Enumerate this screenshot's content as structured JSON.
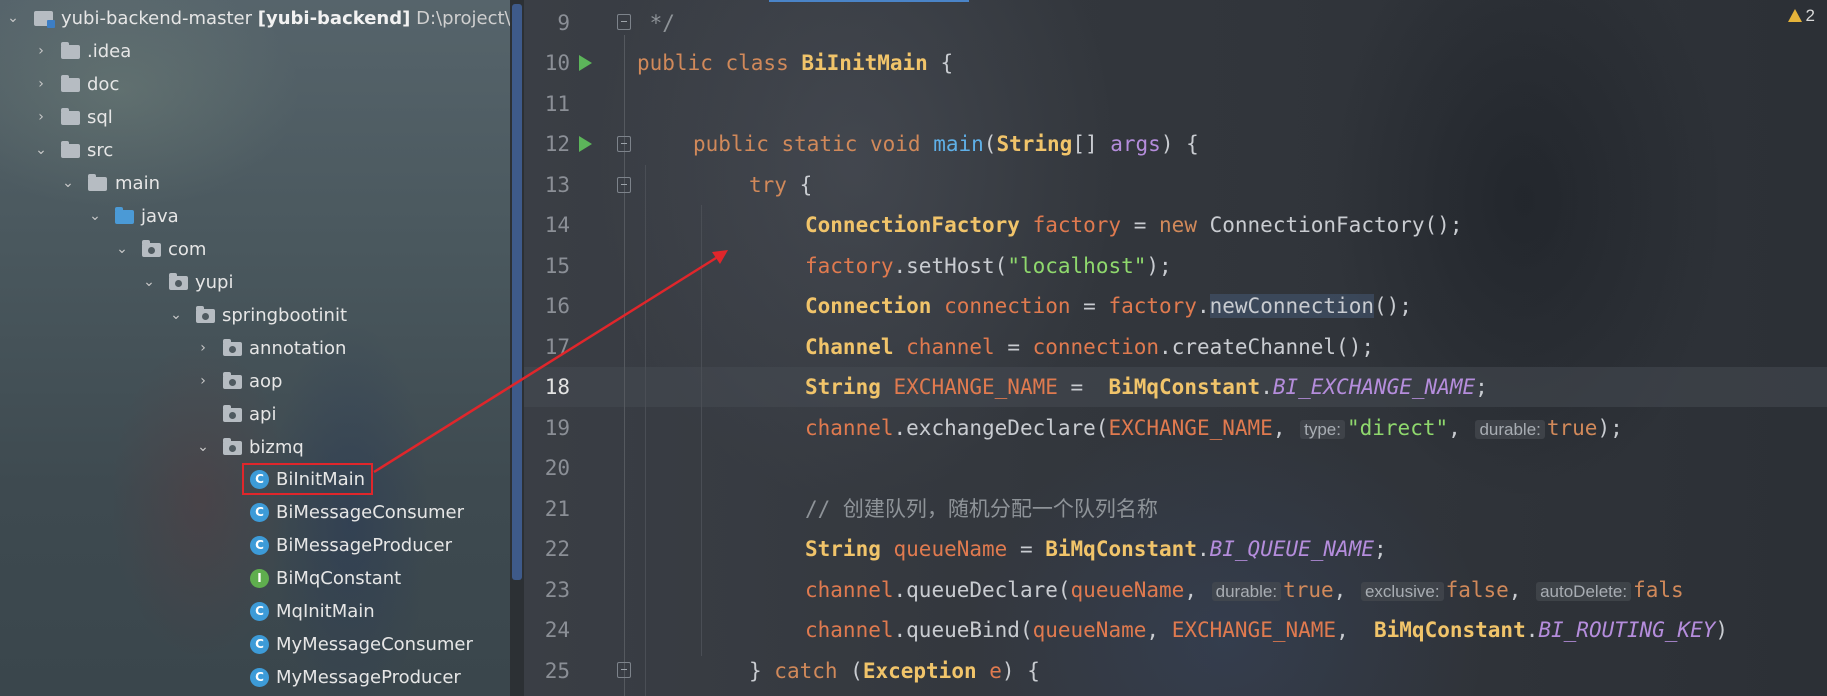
{
  "project_tree": {
    "root": {
      "name": "yubi-backend-master",
      "module": "[yubi-backend]",
      "path": "D:\\project\\BI\\y"
    },
    "items": [
      {
        "label": ".idea"
      },
      {
        "label": "doc"
      },
      {
        "label": "sql"
      },
      {
        "label": "src"
      },
      {
        "label": "main"
      },
      {
        "label": "java"
      },
      {
        "label": "com"
      },
      {
        "label": "yupi"
      },
      {
        "label": "springbootinit"
      },
      {
        "label": "annotation"
      },
      {
        "label": "aop"
      },
      {
        "label": "api"
      },
      {
        "label": "bizmq"
      },
      {
        "label": "BiInitMain"
      },
      {
        "label": "BiMessageConsumer"
      },
      {
        "label": "BiMessageProducer"
      },
      {
        "label": "BiMqConstant"
      },
      {
        "label": "MqInitMain"
      },
      {
        "label": "MyMessageConsumer"
      },
      {
        "label": "MyMessageProducer"
      }
    ]
  },
  "editor": {
    "warnings_count": "2",
    "line_numbers": [
      "9",
      "10",
      "11",
      "12",
      "13",
      "14",
      "15",
      "16",
      "17",
      "18",
      "19",
      "20",
      "21",
      "22",
      "23",
      "24",
      "25"
    ],
    "active_line": "18",
    "tokens": {
      "t9": " */",
      "t10_a": "public class ",
      "t10_b": "BiInitMain",
      "t10_c": " {",
      "t12_a": "public static void ",
      "t12_b": "main",
      "t12_c": "(",
      "t12_d": "String",
      "t12_e": "[] ",
      "t12_f": "args",
      "t12_g": ") {",
      "t13_a": "try",
      "t13_b": " {",
      "t14_a": "ConnectionFactory ",
      "t14_b": "factory",
      "t14_c": " = ",
      "t14_d": "new",
      "t14_e": " ConnectionFactory();",
      "t15_a": "factory",
      "t15_b": ".setHost(",
      "t15_c": "\"localhost\"",
      "t15_d": ");",
      "t16_a": "Connection ",
      "t16_b": "connection",
      "t16_c": " = ",
      "t16_d": "factory",
      "t16_e": ".",
      "t16_f": "newConnection",
      "t16_g": "();",
      "t17_a": "Channel ",
      "t17_b": "channel",
      "t17_c": " = ",
      "t17_d": "connection",
      "t17_e": ".createChannel();",
      "t18_a": "String ",
      "t18_b": "EXCHANGE_NAME",
      "t18_c": " =  ",
      "t18_d": "BiMqConstant",
      "t18_e": ".",
      "t18_f": "BI_EXCHANGE_NAME",
      "t18_g": ";",
      "t19_a": "channel",
      "t19_b": ".exchangeDeclare(",
      "t19_c": "EXCHANGE_NAME",
      "t19_d": ", ",
      "t19_h1": "type:",
      "t19_e": "\"direct\"",
      "t19_f": ", ",
      "t19_h2": "durable:",
      "t19_g": "true",
      "t19_i": ");",
      "t21": "// 创建队列，随机分配一个队列名称",
      "t22_a": "String ",
      "t22_b": "queueName",
      "t22_c": " = ",
      "t22_d": "BiMqConstant",
      "t22_e": ".",
      "t22_f": "BI_QUEUE_NAME",
      "t22_g": ";",
      "t23_a": "channel",
      "t23_b": ".queueDeclare(",
      "t23_c": "queueName",
      "t23_d": ", ",
      "t23_h1": "durable:",
      "t23_e": "true",
      "t23_f": ", ",
      "t23_h2": "exclusive:",
      "t23_g": "false",
      "t23_i": ", ",
      "t23_h3": "autoDelete:",
      "t23_j": "fals",
      "t24_a": "channel",
      "t24_b": ".queueBind(",
      "t24_c": "queueName",
      "t24_d": ", ",
      "t24_e": "EXCHANGE_NAME",
      "t24_f": ",  ",
      "t24_g": "BiMqConstant",
      "t24_h": ".",
      "t24_i": "BI_ROUTING_KEY",
      "t24_j": ")",
      "t25_a": "} ",
      "t25_b": "catch",
      "t25_c": " (",
      "t25_d": "Exception",
      "t25_e": " ",
      "t25_f": "e",
      "t25_g": ") {"
    }
  },
  "colors": {
    "annotation_red": "#e0262b",
    "keyword": "#d1895a",
    "type": "#f1c46a",
    "string": "#8fd86d",
    "field": "#b58ddc"
  }
}
